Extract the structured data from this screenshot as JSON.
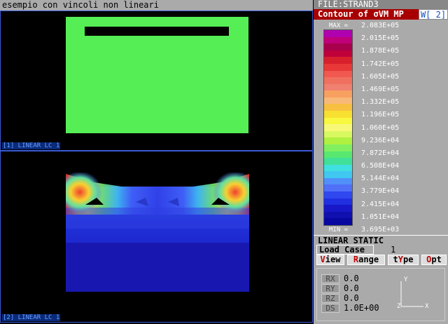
{
  "title": "esempio con vincoli non lineari",
  "file_label": "FILE:STRAND3",
  "contour_title": "Contour of σVM MP",
  "window_badge": "W[ 2]",
  "viewports": [
    {
      "tag": "[1] LINEAR LC 1"
    },
    {
      "tag": "[2] LINEAR LC 1"
    }
  ],
  "legend": {
    "max_tag": "MAX =",
    "min_tag": "MIN =",
    "labels": [
      "2.083E+05",
      "2.015E+05",
      "1.878E+05",
      "1.742E+05",
      "1.605E+05",
      "1.469E+05",
      "1.332E+05",
      "1.196E+05",
      "1.060E+05",
      "9.236E+04",
      "7.872E+04",
      "6.508E+04",
      "5.144E+04",
      "3.779E+04",
      "2.415E+04",
      "1.051E+04",
      "3.695E+03"
    ],
    "colors": [
      "#b000b0",
      "#c0007a",
      "#a8004c",
      "#c0003a",
      "#d8202c",
      "#e83838",
      "#f05850",
      "#f07060",
      "#f08070",
      "#f8a060",
      "#f8b878",
      "#f8c040",
      "#f8e030",
      "#f8f840",
      "#f8f878",
      "#d8f860",
      "#b0f040",
      "#80f060",
      "#58e870",
      "#40e098",
      "#40e0e0",
      "#40c8f0",
      "#5090f8",
      "#5070f8",
      "#3048f0",
      "#2030e0",
      "#1818c8",
      "#1010b0",
      "#0808a0"
    ]
  },
  "analysis_type": "LINEAR STATIC",
  "load_case": {
    "label": "Load Case",
    "value": "1"
  },
  "menu": [
    {
      "hotkey": "V",
      "rest": "iew"
    },
    {
      "hotkey": "R",
      "rest": "ange"
    },
    {
      "pre": "t",
      "hotkey": "Y",
      "rest": "pe"
    },
    {
      "hotkey": "O",
      "rest": "pt"
    }
  ],
  "view_params": [
    {
      "key": "RX",
      "value": "0.0"
    },
    {
      "key": "RY",
      "value": "0.0"
    },
    {
      "key": "RZ",
      "value": "0.0"
    },
    {
      "key": "DS",
      "value": "1.0E+00"
    }
  ],
  "axis_labels": {
    "y": "Y",
    "z": "Z",
    "x": "X"
  }
}
